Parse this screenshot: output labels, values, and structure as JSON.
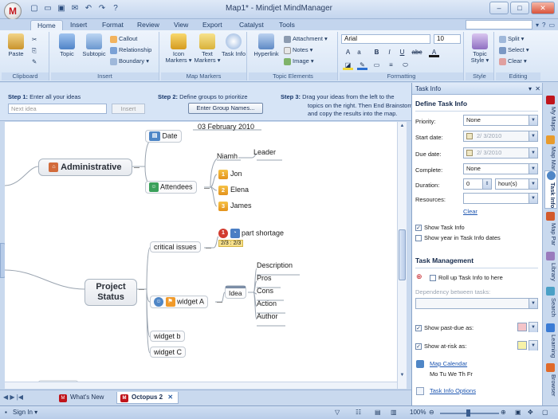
{
  "window": {
    "title": "Map1* - Mindjet MindManager",
    "minimize": "–",
    "maximize": "□",
    "close": "✕"
  },
  "ribbon_tabs": [
    "Home",
    "Insert",
    "Format",
    "Review",
    "View",
    "Export",
    "Catalyst",
    "Tools"
  ],
  "ribbon_right": {
    "help": "?"
  },
  "ribbon": {
    "clipboard": {
      "label": "Clipboard",
      "paste": "Paste"
    },
    "insert": {
      "label": "Insert",
      "topic": "Topic",
      "subtopic": "Subtopic",
      "callout": "Callout",
      "relationship": "Relationship",
      "boundary": "Boundary ▾"
    },
    "map_markers": {
      "label": "Map Markers",
      "icon_markers": "Icon Markers ▾",
      "text_markers": "Text Markers ▾",
      "task_info": "Task Info"
    },
    "topic_elements": {
      "label": "Topic Elements",
      "hyperlink": "Hyperlink",
      "attachment": "Attachment ▾",
      "notes": "Notes ▾",
      "image": "Image ▾"
    },
    "formatting": {
      "label": "Formatting",
      "font": "Arial",
      "size": "10",
      "bold": "B",
      "italic": "I",
      "underline": "U",
      "strike": "abc"
    },
    "style": {
      "label": "Style",
      "topic_style": "Topic Style ▾"
    },
    "editing": {
      "label": "Editing",
      "split": "Split ▾",
      "select": "Select ▾",
      "clear": "Clear ▾"
    }
  },
  "steps": {
    "step1_label": "Step 1:",
    "step1_text": "Enter all your ideas",
    "step2_label": "Step 2:",
    "step2_text": "Define groups to prioritize",
    "step3_label": "Step 3:",
    "step3_text_1": "Drag your ideas from the left to the",
    "step3_text_2": "topics on the right. Then End Brainstorming",
    "step3_text_3": "and copy the results into the map.",
    "idea_placeholder": "Next idea",
    "insert_button": "Insert",
    "enter_group_button": "Enter Group Names..."
  },
  "map": {
    "administrative": "Administrative",
    "date_label": "Date",
    "date_value": "03 February 2010",
    "attendees": "Attendees",
    "niamh": "Niamh",
    "leader": "Leader",
    "jon": "Jon",
    "elena": "Elena",
    "james": "James",
    "attendee_nums": [
      "1",
      "2",
      "3"
    ],
    "project_status": "Project Status",
    "critical_issues": "critical issues",
    "part_shortage": "part shortage",
    "progress_badge": "2/3 : 2/3",
    "widget_a": "widget A",
    "idea": "Idea",
    "description": "Description",
    "pros": "Pros",
    "cons": "Cons",
    "action": "Action",
    "author": "Author",
    "widget_b": "widget b",
    "widget_c": "widget C"
  },
  "doc_tabs": [
    "What's New",
    "Octopus 2"
  ],
  "status_bar": {
    "sign_in": "Sign In ▾",
    "zoom": "100%"
  },
  "task_pane": {
    "header": "Task Info",
    "section_title": "Define Task Info",
    "priority_label": "Priority:",
    "priority_value": "None",
    "start_label": "Start date:",
    "start_value": "2/ 3/2010",
    "due_label": "Due date:",
    "due_value": "2/ 3/2010",
    "complete_label": "Complete:",
    "complete_value": "None",
    "duration_label": "Duration:",
    "duration_value": "0",
    "duration_unit": "hour(s)",
    "resources_label": "Resources:",
    "clear_link": "Clear",
    "show_task_info": "Show Task Info",
    "show_year": "Show year in Task Info dates",
    "management_title": "Task Management",
    "rollup": "Roll up Task Info to here",
    "dependency_label": "Dependency between tasks:",
    "show_past_due": "Show past-due as:",
    "show_at_risk": "Show at-risk as:",
    "map_calendar": "Map Calendar",
    "calendar_days": "Mo Tu We Th Fr",
    "task_info_options": "Task Info Options",
    "colors": {
      "past_due": "#f4c4c9",
      "at_risk": "#f7f2a8"
    }
  },
  "vertical_tabs": [
    "My Maps",
    "Map Mar",
    "Task Info",
    "Map Par",
    "Library",
    "Search",
    "Learning",
    "Browser"
  ]
}
